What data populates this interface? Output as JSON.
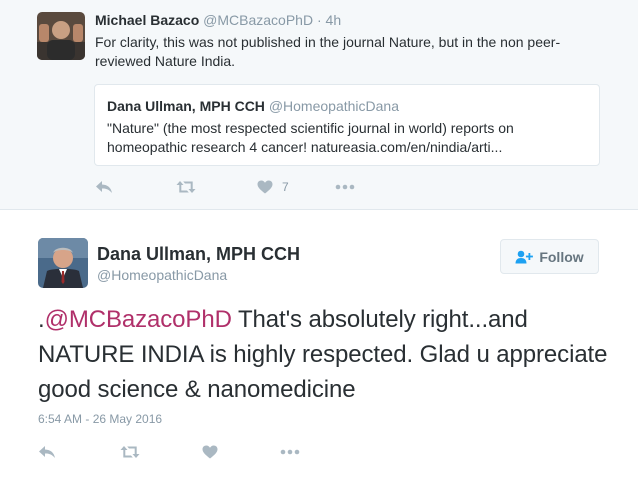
{
  "parent_tweet": {
    "author_name": "Michael Bazaco",
    "author_handle": "@MCBazacoPhD",
    "separator": "·",
    "time": "4h",
    "text": "For clarity, this was not published in the journal Nature, but in the non peer-reviewed Nature India.",
    "quoted": {
      "author_name": "Dana Ullman, MPH CCH",
      "author_handle": "@HomeopathicDana",
      "text": "\"Nature\" (the most respected scientific journal in world) reports on homeopathic research 4 cancer! natureasia.com/en/nindia/arti..."
    },
    "like_count": "7"
  },
  "main_tweet": {
    "author_name": "Dana Ullman, MPH CCH",
    "author_handle": "@HomeopathicDana",
    "follow_label": "Follow",
    "text_prefix": ".",
    "mention": "@MCBazacoPhD",
    "text_rest": " That's absolutely right...and NATURE INDIA is highly respected. Glad u appreciate good science & nanomedicine",
    "timestamp": "6:54 AM - 26 May 2016"
  },
  "colors": {
    "parent_bg": "#f5f8fa",
    "border": "#e1e8ed",
    "mention": "#b0306a",
    "muted": "#8899a6",
    "icon": "#aab8c2",
    "text": "#292f33"
  },
  "icons": {
    "reply": "reply-icon",
    "retweet": "retweet-icon",
    "like": "heart-icon",
    "more": "more-icon",
    "follow": "add-user-icon"
  }
}
